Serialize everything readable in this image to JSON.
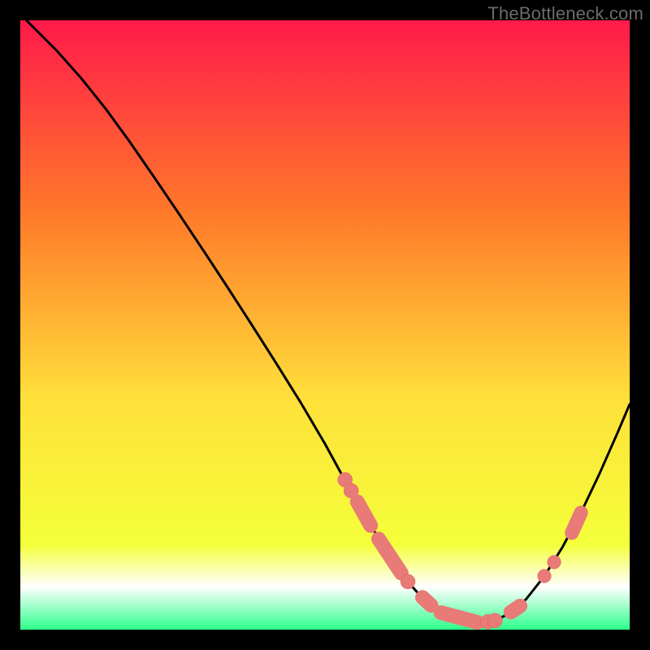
{
  "watermark": "TheBottleneck.com",
  "colors": {
    "frame_bg": "#000000",
    "gradient_top": "#ff1a4a",
    "gradient_mid1": "#ff7a2a",
    "gradient_mid2": "#ffe03a",
    "gradient_mid3": "#f4ff3a",
    "gradient_bottom_band": "#ffffff",
    "gradient_bottom": "#2cff8a",
    "curve": "#000000",
    "marker_fill": "#e87a78",
    "marker_stroke": "#d95f5e"
  },
  "chart_data": {
    "type": "line",
    "title": "",
    "xlabel": "",
    "ylabel": "",
    "xlim": [
      0,
      100
    ],
    "ylim": [
      0,
      100
    ],
    "series": [
      {
        "name": "curve",
        "x": [
          1,
          3,
          6,
          10,
          14,
          18,
          22,
          26,
          30,
          34,
          38,
          42,
          46,
          50,
          53,
          56,
          58,
          60,
          62,
          64,
          66,
          68,
          70,
          72,
          74,
          76,
          78,
          80,
          83,
          86,
          89,
          92,
          95,
          98,
          100
        ],
        "y": [
          100,
          98,
          95,
          90.5,
          85.5,
          80,
          74.2,
          68.3,
          62.3,
          56.2,
          50,
          43.7,
          37.3,
          30.5,
          25,
          19.8,
          16.3,
          13,
          10,
          7.4,
          5.2,
          3.5,
          2.3,
          1.6,
          1.2,
          1.2,
          1.6,
          2.5,
          5,
          8.8,
          13.6,
          19.2,
          25.5,
          32.3,
          37
        ]
      }
    ],
    "markers": [
      {
        "shape": "circle",
        "x": 53.3,
        "y": 24.6,
        "r": 1.2
      },
      {
        "shape": "circle",
        "x": 54.3,
        "y": 22.8,
        "r": 1.2
      },
      {
        "shape": "capsule",
        "x1": 55.3,
        "y1": 21.0,
        "x2": 57.5,
        "y2": 17.1,
        "w": 2.4
      },
      {
        "shape": "capsule",
        "x1": 58.8,
        "y1": 14.9,
        "x2": 62.5,
        "y2": 9.3,
        "w": 2.4
      },
      {
        "shape": "circle",
        "x": 63.6,
        "y": 7.9,
        "r": 1.2
      },
      {
        "shape": "capsule",
        "x1": 66.0,
        "y1": 5.3,
        "x2": 67.4,
        "y2": 4.0,
        "w": 2.4
      },
      {
        "shape": "capsule",
        "x1": 69.0,
        "y1": 2.8,
        "x2": 75.0,
        "y2": 1.2,
        "w": 2.4
      },
      {
        "shape": "circle",
        "x": 76.7,
        "y": 1.3,
        "r": 1.2
      },
      {
        "shape": "circle",
        "x": 77.9,
        "y": 1.5,
        "r": 1.2
      },
      {
        "shape": "capsule",
        "x1": 80.5,
        "y1": 2.9,
        "x2": 82.0,
        "y2": 3.9,
        "w": 2.4
      },
      {
        "shape": "circle",
        "x": 86.0,
        "y": 8.8,
        "r": 1.1
      },
      {
        "shape": "circle",
        "x": 87.6,
        "y": 11.1,
        "r": 1.1
      },
      {
        "shape": "capsule",
        "x1": 90.5,
        "y1": 15.9,
        "x2": 92.0,
        "y2": 19.2,
        "w": 2.3
      }
    ]
  }
}
